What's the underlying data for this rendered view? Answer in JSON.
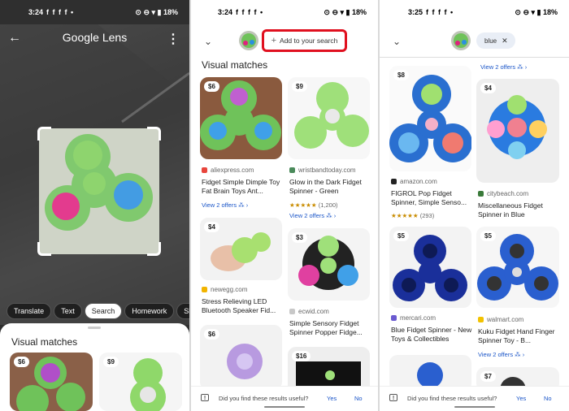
{
  "panel1": {
    "status": {
      "time": "3:24",
      "icons": "f f f f •",
      "right": "⊙ ⊖ ▾ ▮ 18%"
    },
    "title": "Google Lens",
    "chips": [
      "Translate",
      "Text",
      "Search",
      "Homework",
      "Shopping"
    ],
    "active_chip": "Search",
    "sheet_title": "Visual matches",
    "prices": [
      "$6",
      "$9"
    ]
  },
  "panel2": {
    "status": {
      "time": "3:24",
      "icons": "f f f f •",
      "right": "⊙ ⊖ ▾ ▮ 18%"
    },
    "add_label": "Add to your search",
    "section_title": "Visual matches",
    "cards": [
      {
        "price": "$6",
        "source": "aliexpress.com",
        "title": "Fidget Simple Dimple Toy Fat Brain Toys Ant...",
        "offers": "View 2 offers"
      },
      {
        "price": "$9",
        "source": "wristbandtoday.com",
        "title": "Glow in the Dark Fidget Spinner - Green",
        "rating": "★★★★★",
        "count": "(1,200)",
        "offers": "View 2 offers"
      },
      {
        "price": "$4",
        "source": "newegg.com",
        "title": "Stress Relieving LED Bluetooth Speaker Fid..."
      },
      {
        "price": "$3",
        "source": "ecwid.com",
        "title": "Simple Sensory Fidget Spinner Popper Fidge..."
      },
      {
        "price": "$6"
      },
      {
        "price": "$16"
      }
    ],
    "feedback": {
      "question": "Did you find these results useful?",
      "yes": "Yes",
      "no": "No"
    }
  },
  "panel3": {
    "status": {
      "time": "3:25",
      "icons": "f f f f •",
      "right": "⊙ ⊖ ▾ ▮ 18%"
    },
    "chip_label": "blue",
    "top_offers": "View 2 offers",
    "cards": [
      {
        "price": "$8",
        "source": "amazon.com",
        "title": "FIGROL Pop Fidget Spinner, Simple Senso...",
        "rating": "★★★★★",
        "count": "(293)"
      },
      {
        "price": "$4",
        "source": "citybeach.com",
        "title": "Miscellaneous Fidget Spinner in Blue"
      },
      {
        "price": "$5",
        "source": "mercari.com",
        "title": "Blue Fidget Spinner - New Toys & Collectibles"
      },
      {
        "price": "$5",
        "source": "walmart.com",
        "title": "Kuku Fidget Hand Finger Spinner Toy - B...",
        "offers": "View 2 offers"
      },
      {
        "price": "$7"
      }
    ],
    "feedback": {
      "question": "Did you find these results useful?",
      "yes": "Yes",
      "no": "No"
    }
  },
  "colors": {
    "accent_red": "#e0101f",
    "link_blue": "#1a55c8",
    "spinner_green": "#6fc25a"
  }
}
